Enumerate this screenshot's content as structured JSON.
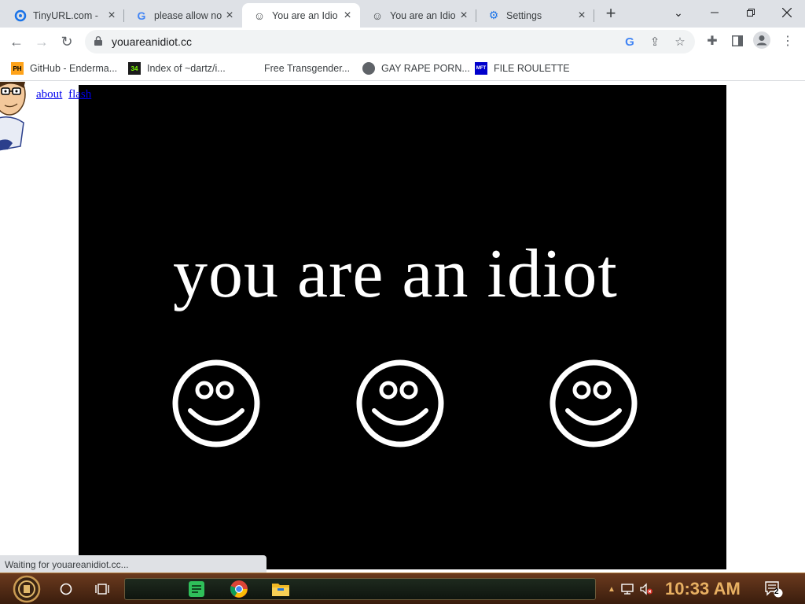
{
  "tabs": [
    {
      "title": "TinyURL.com -",
      "icon": "tinyurl-icon"
    },
    {
      "title": "please allow no",
      "icon": "google-icon"
    },
    {
      "title": "You are an Idio",
      "icon": "smiley-icon"
    },
    {
      "title": "You are an Idio",
      "icon": "smiley-icon"
    },
    {
      "title": "Settings",
      "icon": "gear-icon"
    }
  ],
  "omnibox": {
    "url": "youareanidiot.cc"
  },
  "bookmarks": [
    {
      "label": "GitHub - Enderma...",
      "icon_text": "PH"
    },
    {
      "label": "Index of ~dartz/i...",
      "icon_text": "34"
    },
    {
      "label": "Free Transgender...",
      "icon_text": ""
    },
    {
      "label": "GAY RAPE PORN...",
      "icon_text": ""
    },
    {
      "label": "FILE ROULETTE",
      "icon_text": "MFT"
    }
  ],
  "page": {
    "link_about": "about",
    "link_flash": "flash",
    "headline": "you are an idiot"
  },
  "status_text": "Waiting for youareanidiot.cc...",
  "taskbar": {
    "clock": "10:33 AM",
    "notification_count": "2"
  }
}
